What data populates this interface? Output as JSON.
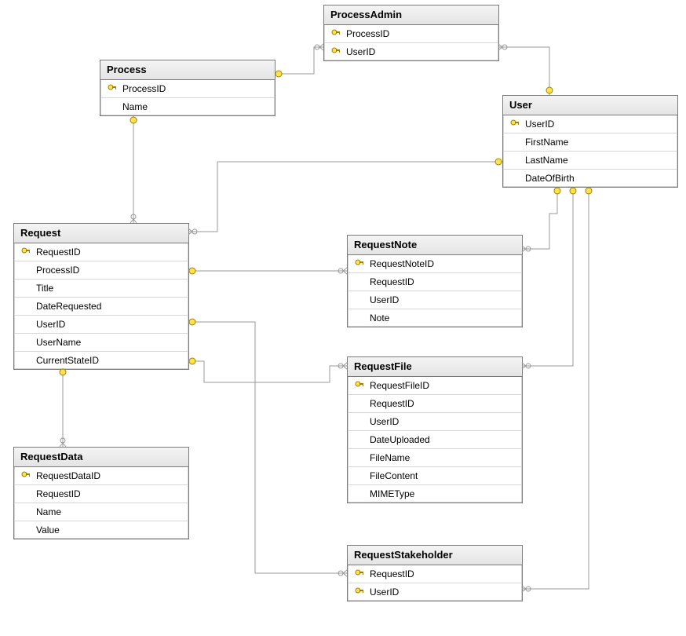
{
  "entities": {
    "process": {
      "name": "Process",
      "columns": [
        {
          "name": "ProcessID",
          "pk": true
        },
        {
          "name": "Name",
          "pk": false
        }
      ]
    },
    "processAdmin": {
      "name": "ProcessAdmin",
      "columns": [
        {
          "name": "ProcessID",
          "pk": true
        },
        {
          "name": "UserID",
          "pk": true
        }
      ]
    },
    "user": {
      "name": "User",
      "columns": [
        {
          "name": "UserID",
          "pk": true
        },
        {
          "name": "FirstName",
          "pk": false
        },
        {
          "name": "LastName",
          "pk": false
        },
        {
          "name": "DateOfBirth",
          "pk": false
        }
      ]
    },
    "request": {
      "name": "Request",
      "columns": [
        {
          "name": "RequestID",
          "pk": true
        },
        {
          "name": "ProcessID",
          "pk": false
        },
        {
          "name": "Title",
          "pk": false
        },
        {
          "name": "DateRequested",
          "pk": false
        },
        {
          "name": "UserID",
          "pk": false
        },
        {
          "name": "UserName",
          "pk": false
        },
        {
          "name": "CurrentStateID",
          "pk": false
        }
      ]
    },
    "requestNote": {
      "name": "RequestNote",
      "columns": [
        {
          "name": "RequestNoteID",
          "pk": true
        },
        {
          "name": "RequestID",
          "pk": false
        },
        {
          "name": "UserID",
          "pk": false
        },
        {
          "name": "Note",
          "pk": false
        }
      ]
    },
    "requestFile": {
      "name": "RequestFile",
      "columns": [
        {
          "name": "RequestFileID",
          "pk": true
        },
        {
          "name": "RequestID",
          "pk": false
        },
        {
          "name": "UserID",
          "pk": false
        },
        {
          "name": "DateUploaded",
          "pk": false
        },
        {
          "name": "FileName",
          "pk": false
        },
        {
          "name": "FileContent",
          "pk": false
        },
        {
          "name": "MIMEType",
          "pk": false
        }
      ]
    },
    "requestStakeholder": {
      "name": "RequestStakeholder",
      "columns": [
        {
          "name": "RequestID",
          "pk": true
        },
        {
          "name": "UserID",
          "pk": true
        }
      ]
    },
    "requestData": {
      "name": "RequestData",
      "columns": [
        {
          "name": "RequestDataID",
          "pk": true
        },
        {
          "name": "RequestID",
          "pk": false
        },
        {
          "name": "Name",
          "pk": false
        },
        {
          "name": "Value",
          "pk": false
        }
      ]
    }
  },
  "relationships": [
    {
      "from": "Process.ProcessID",
      "to": "ProcessAdmin.ProcessID"
    },
    {
      "from": "User.UserID",
      "to": "ProcessAdmin.UserID"
    },
    {
      "from": "Process.ProcessID",
      "to": "Request.ProcessID"
    },
    {
      "from": "User.UserID",
      "to": "Request.UserID"
    },
    {
      "from": "Request.RequestID",
      "to": "RequestNote.RequestID"
    },
    {
      "from": "User.UserID",
      "to": "RequestNote.UserID"
    },
    {
      "from": "Request.RequestID",
      "to": "RequestFile.RequestID"
    },
    {
      "from": "User.UserID",
      "to": "RequestFile.UserID"
    },
    {
      "from": "Request.RequestID",
      "to": "RequestStakeholder.RequestID"
    },
    {
      "from": "User.UserID",
      "to": "RequestStakeholder.UserID"
    },
    {
      "from": "Request.RequestID",
      "to": "RequestData.RequestID"
    }
  ]
}
